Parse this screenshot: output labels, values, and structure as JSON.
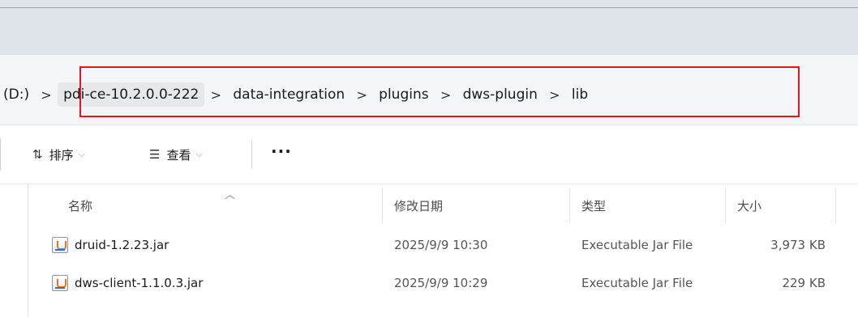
{
  "address": {
    "crumbs": [
      "(D:)",
      "pdi-ce-10.2.0.0-222",
      "data-integration",
      "plugins",
      "dws-plugin",
      "lib"
    ],
    "separator": ">"
  },
  "toolbar": {
    "sort_label": "排序",
    "view_label": "查看",
    "more_label": "···"
  },
  "columns": {
    "name": "名称",
    "date": "修改日期",
    "type": "类型",
    "size": "大小"
  },
  "files": [
    {
      "name": "druid-1.2.23.jar",
      "date": "2025/9/9 10:30",
      "type": "Executable Jar File",
      "size": "3,973 KB",
      "icon": "jar-file-icon"
    },
    {
      "name": "dws-client-1.1.0.3.jar",
      "date": "2025/9/9 10:29",
      "type": "Executable Jar File",
      "size": "229 KB",
      "icon": "jar-file-icon"
    }
  ],
  "colors": {
    "highlight_border": "#e0171f",
    "titlebar": "#dfe4ea",
    "addressbar": "#f3f5f8"
  }
}
